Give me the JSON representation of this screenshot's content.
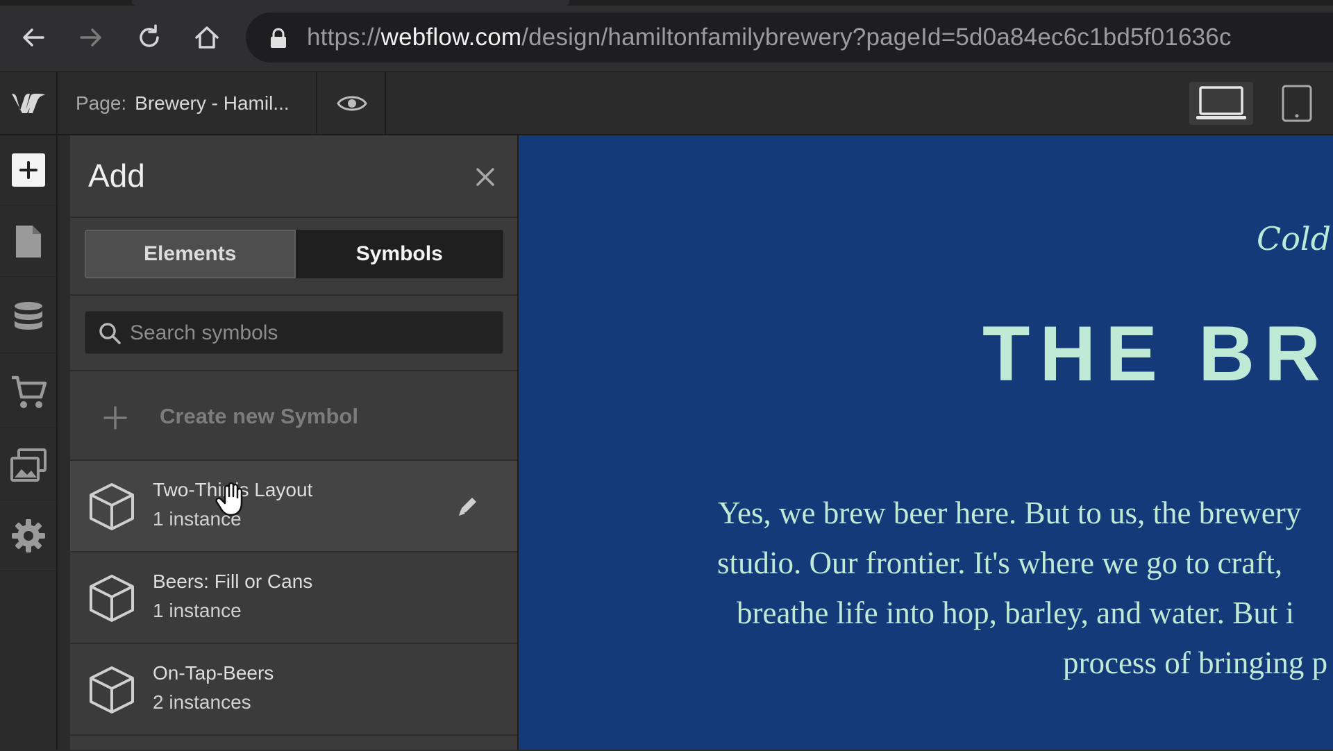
{
  "browser": {
    "url_host": "webflow.com",
    "url_prefix": "https://",
    "url_path": "/design/hamiltonfamilybrewery?pageId=5d0a84ec6c1bd5f01636c"
  },
  "topbar": {
    "page_label": "Page:",
    "page_name": "Brewery - Hamil..."
  },
  "panel": {
    "title": "Add",
    "tabs": [
      {
        "label": "Elements",
        "active": false
      },
      {
        "label": "Symbols",
        "active": true
      }
    ],
    "search": {
      "placeholder": "Search symbols",
      "value": ""
    },
    "create_label": "Create new Symbol",
    "symbols": [
      {
        "name": "Two-Thirds Layout",
        "count": "1 instance"
      },
      {
        "name": "Beers: Fill or Cans",
        "count": "1 instance"
      },
      {
        "name": "On-Tap-Beers",
        "count": "2 instances"
      }
    ]
  },
  "canvas": {
    "tagline": "Cold I",
    "heading": "THE BR",
    "body_lines": [
      "Yes, we brew beer here. But to us, the brewery",
      "studio. Our frontier. It's where we go to craft,",
      "breathe life into hop, barley, and water. But i",
      "process of bringing p"
    ]
  },
  "colors": {
    "canvas_bg": "#153a7a",
    "canvas_text": "#bfead6",
    "panel_bg": "#3b3b3b",
    "chrome_bg": "#2b2b2b"
  },
  "icons": {
    "browser": [
      "back-arrow-icon",
      "forward-arrow-icon",
      "reload-icon",
      "home-icon",
      "lock-icon"
    ],
    "topbar": [
      "webflow-logo-icon",
      "eye-icon",
      "desktop-icon",
      "tablet-icon"
    ],
    "rail": [
      "plus-icon",
      "pages-icon",
      "database-icon",
      "cart-icon",
      "assets-icon",
      "gear-icon"
    ],
    "panel": [
      "close-icon",
      "search-icon",
      "plus-icon",
      "cube-icon",
      "pencil-icon"
    ]
  }
}
